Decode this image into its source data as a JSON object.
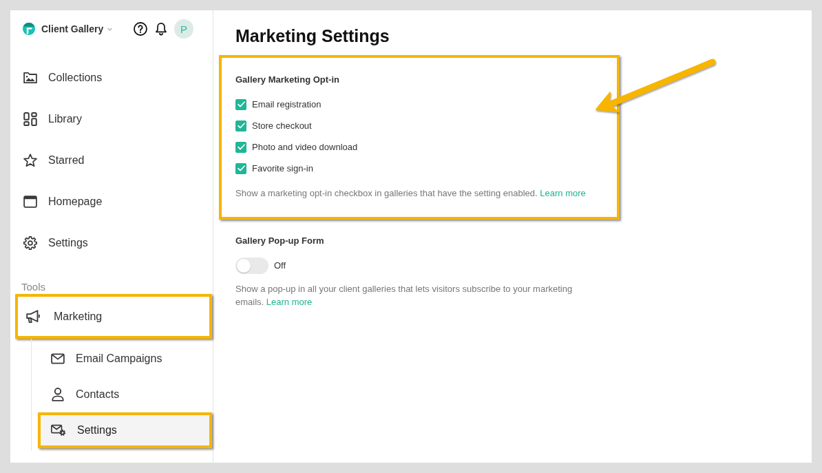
{
  "sidebar": {
    "brand": "Client Gallery",
    "avatar_initial": "P",
    "items": [
      {
        "label": "Collections",
        "selected": false,
        "highlighted": false
      },
      {
        "label": "Library",
        "selected": false,
        "highlighted": false
      },
      {
        "label": "Starred",
        "selected": false,
        "highlighted": false
      },
      {
        "label": "Homepage",
        "selected": false,
        "highlighted": false
      },
      {
        "label": "Settings",
        "selected": false,
        "highlighted": false
      }
    ],
    "tools_heading": "Tools",
    "tools": [
      {
        "label": "Marketing",
        "selected": false,
        "highlighted": true,
        "children": [
          {
            "label": "Email Campaigns",
            "selected": false,
            "highlighted": false
          },
          {
            "label": "Contacts",
            "selected": false,
            "highlighted": false
          },
          {
            "label": "Settings",
            "selected": true,
            "highlighted": true
          }
        ]
      }
    ]
  },
  "page": {
    "title": "Marketing Settings"
  },
  "sections": [
    {
      "kind": "checklist",
      "title": "Gallery Marketing Opt-in",
      "highlighted": true,
      "callout_arrow": true,
      "options": [
        {
          "label": "Email registration",
          "checked": true
        },
        {
          "label": "Store checkout",
          "checked": true
        },
        {
          "label": "Photo and video download",
          "checked": true
        },
        {
          "label": "Favorite sign-in",
          "checked": true
        }
      ],
      "description": "Show a marketing opt-in checkbox in galleries that have the setting enabled.",
      "link": "Learn more"
    },
    {
      "kind": "toggle",
      "title": "Gallery Pop-up Form",
      "highlighted": false,
      "callout_arrow": false,
      "on": false,
      "state_label": "Off",
      "description": "Show a pop-up in all your client galleries that lets visitors subscribe to your marketing emails.",
      "link": "Learn more"
    }
  ]
}
